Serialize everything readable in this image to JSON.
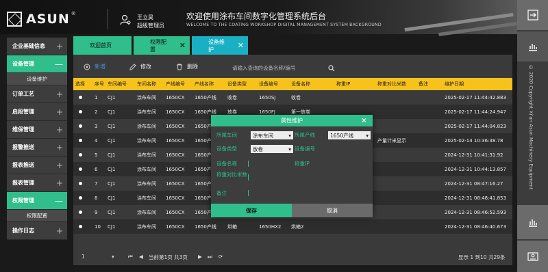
{
  "header": {
    "logo_text": "ASUN",
    "logo_reg": "®",
    "user_name": "王立昊",
    "user_role": "超级管理员",
    "title_cn": "欢迎使用涂布车间数字化管理系统后台",
    "title_en": "WELCOME TO THE COATING WORKSHOP DIGITAL MANAGEMENT SYSTEM BACKGROUND"
  },
  "sidebar": {
    "items": [
      {
        "label": "企业基础信息",
        "sign": "+"
      },
      {
        "label": "设备管理",
        "sign": "—"
      },
      {
        "label": "设备维护"
      },
      {
        "label": "订单工艺",
        "sign": "+"
      },
      {
        "label": "启段管理",
        "sign": "+"
      },
      {
        "label": "维保管理",
        "sign": "+"
      },
      {
        "label": "报警推送",
        "sign": "+"
      },
      {
        "label": "报表推送",
        "sign": "+"
      },
      {
        "label": "报表管理",
        "sign": "+"
      },
      {
        "label": "权限管理",
        "sign": "—"
      },
      {
        "label": "权限配置"
      },
      {
        "label": "操作日志",
        "sign": "+"
      }
    ]
  },
  "tabs": [
    {
      "label": "欢迎首页",
      "close": ""
    },
    {
      "label": "权限配置",
      "close": "✕"
    },
    {
      "label": "设备维护",
      "close": "✕"
    }
  ],
  "toolbar": {
    "add_label": "新增",
    "edit_label": "修改",
    "delete_label": "删除",
    "search_placeholder": "请输入查询的设备名称/编号"
  },
  "table": {
    "headers": [
      "选择",
      "序号",
      "车间编号",
      "车间名称",
      "产线编号",
      "产线名称",
      "设备类型",
      "设备编号",
      "设备名称",
      "称重IP",
      "称重对比米数",
      "备注",
      "维护日期"
    ],
    "rows": [
      [
        "1",
        "CJ1",
        "涂布车间",
        "1650CX",
        "1650产线",
        "收卷",
        "1650SJ",
        "收卷",
        "",
        "",
        "",
        "2025-02-17 11:44:42.883"
      ],
      [
        "2",
        "CJ1",
        "涂布车间",
        "1650CX",
        "1650产线",
        "放卷",
        "1650FJ",
        "第一放卷",
        "",
        "",
        "",
        "2025-02-17 11:44:24.947"
      ],
      [
        "3",
        "CJ1",
        "涂布车间",
        "1650CX",
        "1650产线",
        "",
        "",
        "",
        "",
        "",
        "",
        "2025-02-17 11:44:04.823"
      ],
      [
        "4",
        "CJ1",
        "涂布车间",
        "1650CX",
        "1650产线",
        "",
        "",
        "",
        "",
        "产量计米显示",
        "",
        "2025-02-14 10:36:38.78"
      ],
      [
        "5",
        "CJ1",
        "涂布车间",
        "1650CX",
        "1650产线",
        "",
        "",
        "",
        "",
        "",
        "",
        "2024-12-31 10:41:31.92"
      ],
      [
        "6",
        "CJ1",
        "涂布车间",
        "1650CX",
        "1650产线",
        "",
        "",
        "",
        "",
        "",
        "",
        "2024-12-31 10:44:13.857"
      ],
      [
        "7",
        "CJ1",
        "涂布车间",
        "1650CX",
        "1650产线",
        "",
        "",
        "",
        "",
        "",
        "",
        "2024-12-31 08:47:16.27"
      ],
      [
        "8",
        "CJ1",
        "涂布车间",
        "1650CX",
        "1650产线",
        "",
        "",
        "",
        "",
        "",
        "",
        "2024-12-31 08:48:41.853"
      ],
      [
        "9",
        "CJ1",
        "涂布车间",
        "1650CX",
        "1650产线",
        "",
        "",
        "",
        "",
        "",
        "",
        "2024-12-31 08:46:52.593"
      ],
      [
        "10",
        "CJ1",
        "涂布车间",
        "1650CX",
        "1650产线",
        "烘箱",
        "1650HX2",
        "烘箱2",
        "",
        "",
        "",
        "2024-12-31 08:46:40.673"
      ]
    ]
  },
  "pager": {
    "page_input": "1",
    "page_text": "当前第1页  共3页",
    "summary": "显示 1 到10 共29条"
  },
  "dialog": {
    "title": "属性维护",
    "close": "✕",
    "workshop_label": "所属车间",
    "workshop_value": "涂布车间",
    "line_label": "所属产线",
    "line_value": "1650产线",
    "type_label": "设备类型",
    "type_value": "放卷",
    "code_label": "设备编号",
    "name_label": "设备名称",
    "ip_label": "称重IP",
    "meter_label": "称重对比米数",
    "remark_label": "备注",
    "save_label": "保存",
    "cancel_label": "取消"
  },
  "copyright": "© 2020 Copyright Xi'an Asun Machinery Equipment",
  "colors": {
    "accent": "#2fbe8c",
    "tab_active": "#1ab0c4",
    "header_yellow": "#f6c21b"
  }
}
